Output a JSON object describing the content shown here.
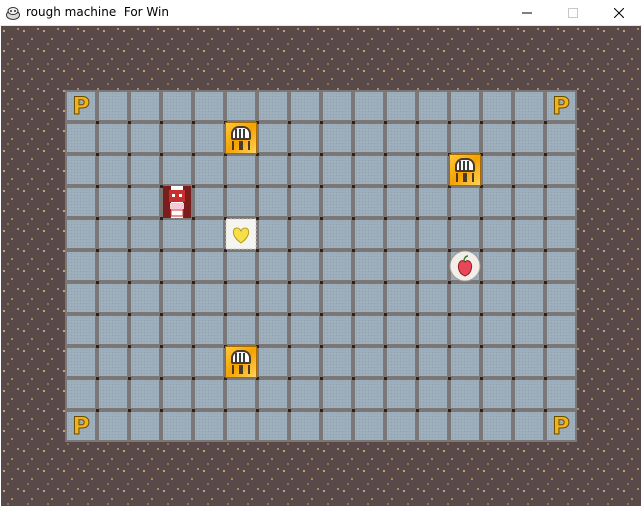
{
  "window": {
    "title": "rough machine  For Win",
    "controls": {
      "minimize": "minimize",
      "maximize": "maximize",
      "close": "close"
    }
  },
  "board": {
    "cols": 16,
    "rows": 11,
    "corner_label": "P",
    "corner_markers": [
      {
        "name": "p-marker-top-left",
        "col": 0,
        "row": 0
      },
      {
        "name": "p-marker-top-right",
        "col": 15,
        "row": 0
      },
      {
        "name": "p-marker-bottom-left",
        "col": 0,
        "row": 10
      },
      {
        "name": "p-marker-bottom-right",
        "col": 15,
        "row": 10
      }
    ],
    "robots": [
      {
        "name": "robot-tile",
        "col": 5,
        "row": 1
      },
      {
        "name": "robot-tile",
        "col": 12,
        "row": 2
      },
      {
        "name": "robot-tile",
        "col": 5,
        "row": 8
      }
    ],
    "player": {
      "name": "player-character",
      "col": 3,
      "row": 3
    },
    "items": [
      {
        "name": "yellow-heart-item",
        "col": 5,
        "row": 4,
        "kind": "heart",
        "color": "#f7df4a"
      },
      {
        "name": "red-fruit-item",
        "col": 12,
        "row": 5,
        "kind": "fruit",
        "color": "#e8475a"
      }
    ]
  },
  "colors": {
    "background": "#594948",
    "cell": "#9fb0bd",
    "grid_line": "#7b7776",
    "marker": "#f1b418",
    "robot": "#f5a200"
  }
}
